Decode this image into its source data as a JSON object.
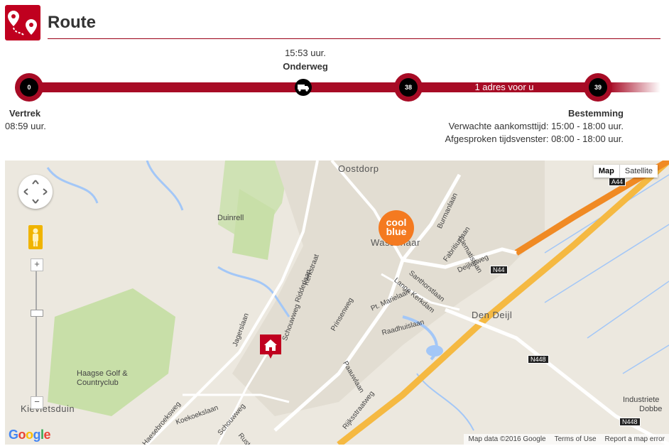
{
  "header": {
    "title": "Route",
    "icon": "route-pins-icon",
    "accent": "#c0001f"
  },
  "progress": {
    "current_time": "15:53 uur.",
    "current_status": "Onderweg",
    "addresses_before": "1 adres voor u",
    "stops": [
      {
        "number": "0"
      },
      {
        "number": "38"
      },
      {
        "number": "39"
      }
    ]
  },
  "departure": {
    "label": "Vertrek",
    "time": "08:59 uur."
  },
  "destination": {
    "label": "Bestemming",
    "eta": "Verwachte aankomsttijd: 15:00 - 18:00 uur.",
    "window": "Afgesproken tijdsvenster: 08:00 - 18:00 uur."
  },
  "map": {
    "type_map": "Map",
    "type_satellite": "Satellite",
    "zoom_in": "+",
    "zoom_out": "−",
    "logo": "Google",
    "attribution": "Map data ©2016 Google",
    "terms": "Terms of Use",
    "report": "Report a map error",
    "places": {
      "oostdorp": "Oostdorp",
      "wassenaar": "Wassenaar",
      "duinrell": "Duinrell",
      "den_deijl": "Den Deijl",
      "golf": "Haagse Golf &",
      "golf2": "Countryclub",
      "kievietsduin": "Kievietsduin",
      "industrie": "Industriete",
      "dobbe": "Dobbe"
    },
    "streets": {
      "burmanlaan": "Burmanlaan",
      "clematislaan": "Clematislaan",
      "fabritiuslaan": "Fabritiuslaan",
      "deijlerweg": "Deijlerweg",
      "santhorstlaan": "Santhorstlaan",
      "lange_kerkdam": "Lange Kerkdam",
      "pt_marielaan": "Pt. Marielaan",
      "raadhuislaan": "Raadhuislaan",
      "kerkstraat": "Kerkstraat",
      "ridderlaan": "Ridderlaan",
      "prinsenweg": "Prinsenweg",
      "schouwweg": "Schouwweg",
      "jagerslaan": "Jagerslaan",
      "paauwlaan": "Paauwlaan",
      "rijksstraatweg": "Rijksstraatweg",
      "haesebroeksweg": "Haesebroeksweg",
      "koekoekslaan": "Koekoekslaan",
      "schouwweg2": "Schouwweg",
      "rust_en": "Rust en"
    },
    "shields": {
      "a44": "A44",
      "n44": "N44",
      "n448": "N448",
      "n448b": "N448"
    },
    "store_logo": "cool blue",
    "colors": {
      "land": "#ece8df",
      "park": "#c8dfa8",
      "water": "#a3c7f7",
      "highway": "#f5b942",
      "motorway": "#f08a24",
      "store": "#f47a20",
      "home": "#c0001f"
    }
  }
}
